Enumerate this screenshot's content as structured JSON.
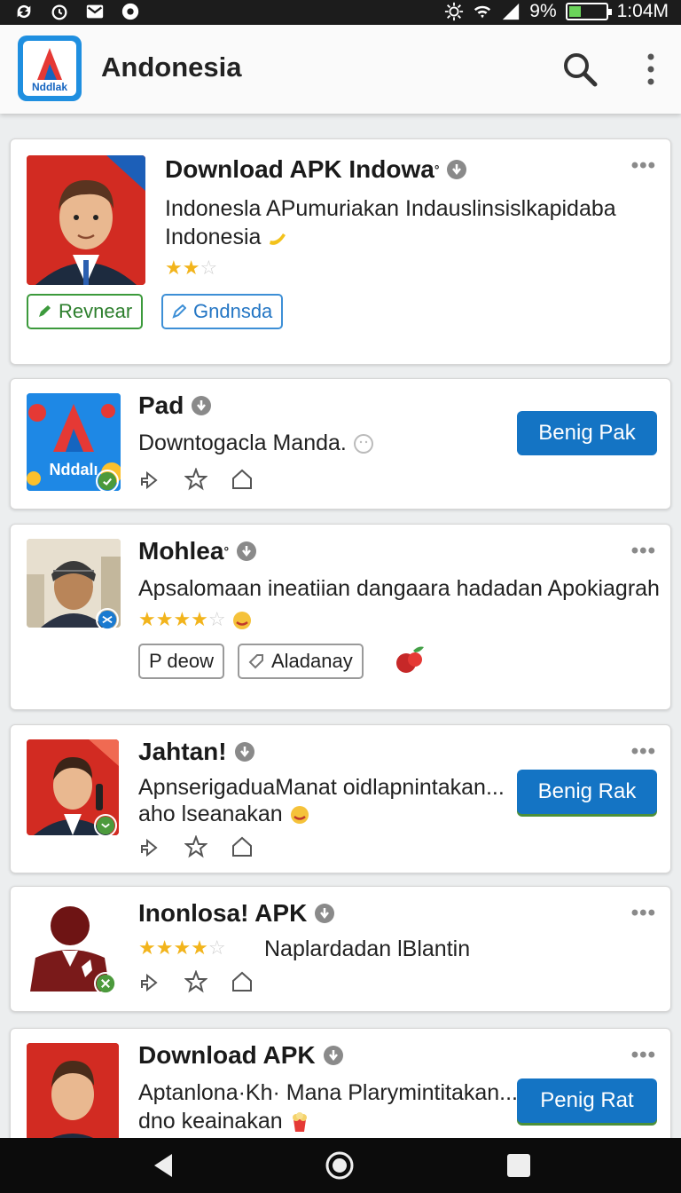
{
  "status_bar": {
    "battery": "9%",
    "time": "1:04M"
  },
  "app_bar": {
    "logo_text": "Nddlak",
    "title": "Andonesia"
  },
  "items": [
    {
      "name": "Download APK Indowa",
      "name_mark": "°",
      "desc_line1": "Indonesla APumuriakan Indauslinsislkapidaba",
      "desc_line2": "Indonesia",
      "rating": 2,
      "chips": [
        "Revnear",
        "Gndnsda"
      ]
    },
    {
      "name": "Pad",
      "thumb_text": "Nddalı",
      "desc": "Downtogacla Manda.",
      "button": "Benig Pak"
    },
    {
      "name": "Mohlea",
      "name_mark": "°",
      "desc": "Apsalomaan ineatiian dangaara hadadan Apokiagrah",
      "rating": 4,
      "chips": [
        "P deow",
        "Aladanay"
      ]
    },
    {
      "name": "Jahtan!",
      "desc_line1": "ApnserigaduaManat oidlapnintakan...",
      "desc_line2": "aho lseanakan",
      "button": "Benig Rak"
    },
    {
      "name": "Inonlosa! APK",
      "rating": 3.5,
      "desc": "Naplardadan lBlantin"
    },
    {
      "name": "Download APK",
      "desc_line1": "Aptanlona·Kh· Mana Plarymintitakan...",
      "desc_line2": "dno keainakan",
      "button": "Penig Rat"
    }
  ],
  "colors": {
    "accent": "#1474c4",
    "star": "#f2b41c",
    "green_chip": "#3c9a3c",
    "blue_chip": "#3d8fd6",
    "badge_green": "#4c9a3c",
    "badge_blue": "#1a7ad0"
  }
}
